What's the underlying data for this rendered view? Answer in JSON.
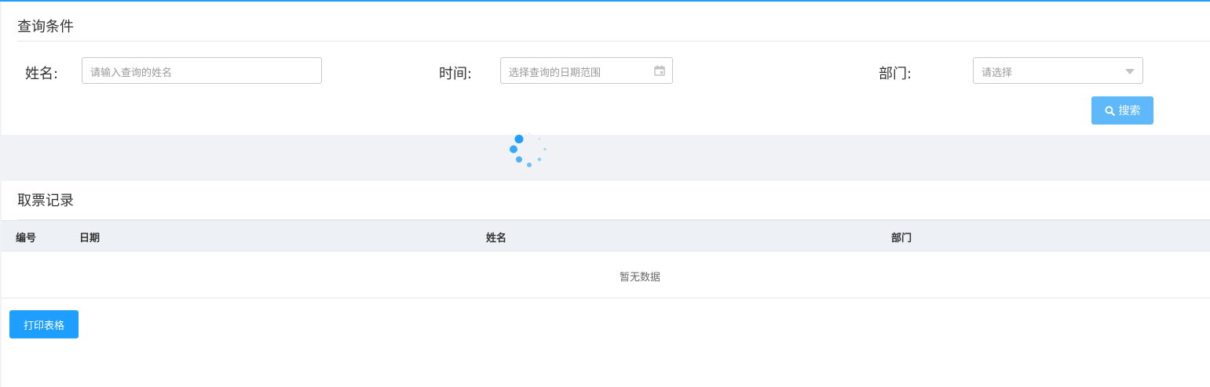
{
  "query": {
    "title": "查询条件",
    "name_label": "姓名:",
    "name_placeholder": "请输入查询的姓名",
    "time_label": "时间:",
    "date_placeholder": "选择查询的日期范围",
    "dept_label": "部门:",
    "dept_placeholder": "请选择",
    "search_label": "搜索"
  },
  "records": {
    "title": "取票记录",
    "columns": [
      "编号",
      "日期",
      "姓名",
      "部门"
    ],
    "empty_text": "暂无数据",
    "print_label": "打印表格"
  },
  "colors": {
    "accent": "#1e9fff",
    "search_button": "#5fb8fa",
    "loading_band": "#f0f2f5",
    "table_header": "#edf0f4"
  },
  "icons": [
    "calendar-icon",
    "chevron-down-icon",
    "search-icon",
    "loading-spinner-icon"
  ]
}
